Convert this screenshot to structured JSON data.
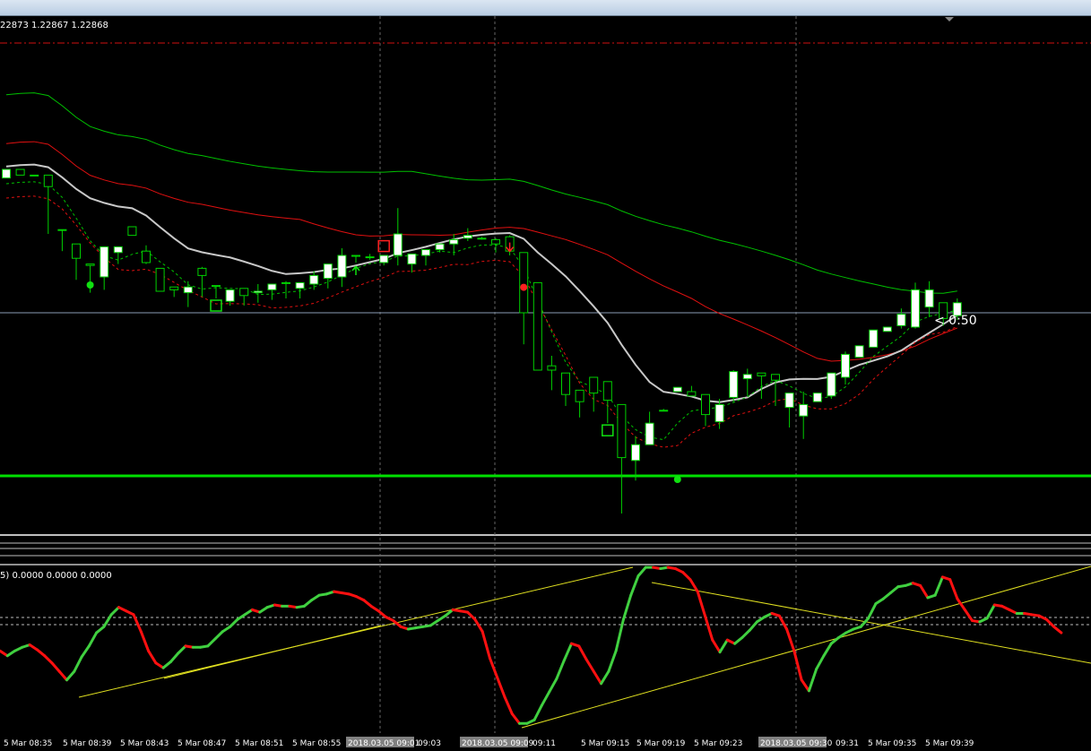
{
  "window": {
    "title_bar": ""
  },
  "price_panel": {
    "ohlc_text": "22873 1.22867 1.22868",
    "countdown": "< 0:50"
  },
  "oscillator_panel": {
    "readout": "5) 0.0000 0.0000 0.0000"
  },
  "colors": {
    "background": "#000000",
    "bull": "#ffffff",
    "bear": "#000000",
    "wick": "#00d000",
    "support_line": "#00e000",
    "resistance_line": "#d01010",
    "ma_green": "#00c000",
    "ma_red": "#e01010",
    "ma_gray": "#c8c8c8",
    "osc_up": "#40d040",
    "osc_down": "#ff1010",
    "trendline": "#e0e020"
  },
  "chart_data": [
    {
      "type": "candlestick",
      "title": "",
      "x_tick_labels": [
        "5 Mar 08:35",
        "5 Mar 08:39",
        "5 Mar 08:43",
        "5 Mar 08:47",
        "5 Mar 08:51",
        "5 Mar 08:55",
        "2018.03.05 09:01",
        "09:03",
        "2018.03.05 09:09",
        "09:11",
        "5 Mar 09:15",
        "5 Mar 09:19",
        "5 Mar 09:23",
        "2018.03.05 09:30",
        "09:31",
        "5 Mar 09:35",
        "5 Mar 09:39"
      ],
      "candles": [
        [
          1,
          100,
          94,
          89,
          100
        ],
        [
          0,
          100,
          96,
          88,
          96
        ],
        [
          1,
          96,
          96,
          90,
          96
        ],
        [
          0,
          96,
          88,
          60,
          55
        ],
        [
          0,
          58,
          58,
          50,
          43
        ],
        [
          0,
          48,
          38,
          32,
          23
        ],
        [
          0,
          34,
          33,
          32,
          14
        ],
        [
          1,
          25,
          46,
          45,
          16
        ],
        [
          1,
          42,
          46,
          44,
          34
        ],
        [
          0,
          60,
          54,
          57,
          57
        ],
        [
          0,
          35,
          43,
          47,
          34
        ],
        [
          0,
          31,
          15,
          16,
          31
        ],
        [
          0,
          16,
          18,
          16,
          11
        ],
        [
          1,
          14,
          18,
          22,
          4
        ],
        [
          0,
          26,
          31,
          32,
          11
        ],
        [
          0,
          19,
          19,
          10,
          10
        ],
        [
          1,
          8,
          16,
          10,
          5
        ],
        [
          0,
          12,
          17,
          13,
          5
        ],
        [
          1,
          14,
          15,
          20,
          7
        ],
        [
          1,
          16,
          20,
          13,
          9
        ],
        [
          0,
          21,
          21,
          22,
          10
        ],
        [
          1,
          17,
          21,
          21,
          10
        ],
        [
          1,
          20,
          26,
          29,
          16
        ],
        [
          1,
          24,
          34,
          29,
          17
        ],
        [
          1,
          25,
          40,
          45,
          18
        ],
        [
          0,
          40,
          40,
          40,
          35
        ],
        [
          1,
          39,
          39,
          41,
          37
        ],
        [
          1,
          35,
          40,
          39,
          33
        ],
        [
          1,
          40,
          55,
          73,
          33
        ],
        [
          1,
          34,
          41,
          40,
          28
        ],
        [
          1,
          40,
          44,
          44,
          33
        ],
        [
          1,
          44,
          48,
          48,
          42
        ],
        [
          1,
          48,
          51,
          55,
          40
        ],
        [
          1,
          52,
          54,
          59,
          50
        ],
        [
          0,
          52,
          52,
          53,
          51
        ],
        [
          0,
          51,
          48,
          52,
          42
        ],
        [
          0,
          53,
          43,
          54,
          40
        ],
        [
          0,
          42,
          0,
          14,
          -22
        ],
        [
          0,
          21,
          -40,
          -14,
          -33
        ],
        [
          0,
          -37,
          -40,
          -30,
          -54
        ],
        [
          0,
          -57,
          -42,
          -61,
          -65
        ],
        [
          0,
          -62,
          -54,
          -60,
          -73
        ],
        [
          0,
          -45,
          -56,
          -45,
          -69
        ],
        [
          0,
          -48,
          -61,
          -67,
          -77
        ],
        [
          0,
          -64,
          -101,
          -96,
          -140
        ],
        [
          1,
          -103,
          -92,
          -86,
          -117
        ],
        [
          1,
          -92,
          -77,
          -69,
          -89
        ],
        [
          1,
          -68,
          -68,
          -67,
          -60
        ],
        [
          1,
          -52,
          -55,
          -53,
          -52
        ],
        [
          0,
          -55,
          -58,
          -51,
          -52
        ],
        [
          0,
          -57,
          -71,
          -65,
          -79
        ],
        [
          1,
          -76,
          -64,
          -60,
          -81
        ],
        [
          1,
          -59,
          -41,
          -40,
          -62
        ],
        [
          1,
          -46,
          -43,
          -39,
          -58
        ],
        [
          0,
          -44,
          -42,
          -46,
          -60
        ],
        [
          0,
          -43,
          -47,
          -63,
          -65
        ],
        [
          1,
          -66,
          -56,
          -72,
          -80
        ],
        [
          1,
          -72,
          -64,
          -55,
          -88
        ],
        [
          1,
          -62,
          -56,
          -59,
          -61
        ],
        [
          1,
          -58,
          -42,
          -45,
          -60
        ],
        [
          1,
          -45,
          -29,
          -27,
          -50
        ],
        [
          1,
          -31,
          -23,
          -26,
          -31
        ],
        [
          1,
          -24,
          -12,
          -13,
          -24
        ],
        [
          1,
          -10,
          -13,
          -12,
          -8
        ],
        [
          1,
          -9,
          -1,
          3,
          -11
        ],
        [
          1,
          -10,
          16,
          21,
          -11
        ],
        [
          1,
          16,
          4,
          22,
          -3
        ],
        [
          0,
          7,
          -4,
          -1,
          -9
        ],
        [
          1,
          -2,
          7,
          10,
          -5
        ]
      ],
      "candle_format": "[bullish(1)/bearish(0), open, close, high, low] relative to price scale (not shown)",
      "horizontal_lines": [
        {
          "name": "resistance",
          "style": "dash-dot"
        },
        {
          "name": "support",
          "style": "solid"
        },
        {
          "name": "current-price",
          "style": "solid"
        }
      ],
      "markers": [
        {
          "name": "buy-arrow",
          "x_index": 25,
          "type": "up-arrow"
        },
        {
          "name": "sell-arrow",
          "x_index": 36,
          "type": "down-arrow"
        },
        {
          "name": "green-dot-1",
          "x_index": 6,
          "type": "dot"
        },
        {
          "name": "green-dot-2",
          "x_index": 48,
          "type": "dot"
        },
        {
          "name": "red-dot",
          "x_index": 37,
          "type": "dot"
        },
        {
          "name": "red-box",
          "x_index": 27,
          "type": "box"
        },
        {
          "name": "green-box-1",
          "x_index": 15,
          "type": "box"
        },
        {
          "name": "green-box-2",
          "x_index": 43,
          "type": "box"
        }
      ]
    },
    {
      "type": "line",
      "title": "",
      "series_note": "oscillator line colored green when rising, red when falling",
      "values": [
        62,
        58,
        62,
        65,
        67,
        63,
        58,
        52,
        45,
        38,
        45,
        57,
        66,
        77,
        82,
        92,
        98,
        95,
        92,
        78,
        62,
        52,
        48,
        53,
        60,
        66,
        65,
        65,
        66,
        72,
        78,
        82,
        88,
        92,
        96,
        94,
        98,
        100,
        99,
        99,
        98,
        99,
        104,
        108,
        109,
        111,
        110,
        109,
        107,
        104,
        99,
        95,
        90,
        87,
        82,
        80,
        81,
        82,
        83,
        87,
        91,
        96,
        95,
        94,
        88,
        78,
        56,
        40,
        24,
        10,
        2,
        2,
        5,
        17,
        28,
        39,
        54,
        68,
        66,
        55,
        45,
        35,
        45,
        62,
        88,
        108,
        124,
        131,
        131,
        130,
        131,
        130,
        127,
        121,
        111,
        91,
        71,
        61,
        71,
        68,
        73,
        79,
        86,
        90,
        93,
        91,
        80,
        62,
        38,
        29,
        47,
        58,
        68,
        73,
        77,
        80,
        82,
        89,
        101,
        105,
        110,
        115,
        116,
        118,
        116,
        106,
        108,
        123,
        121,
        105,
        96,
        87,
        86,
        89,
        100,
        99,
        96,
        93,
        93,
        92,
        91,
        88,
        82,
        77
      ],
      "trendlines": 4,
      "reference_levels": 2
    }
  ]
}
